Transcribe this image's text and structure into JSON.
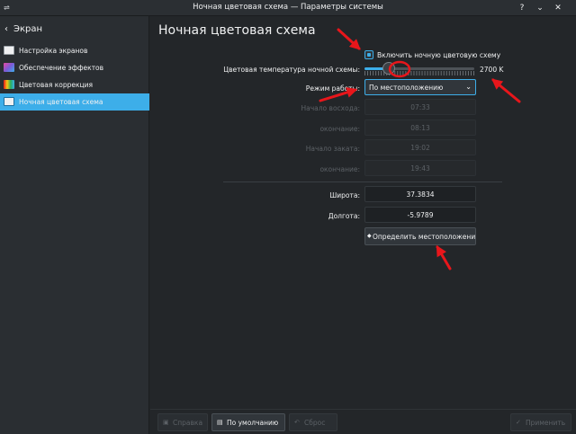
{
  "window": {
    "title": "Ночная цветовая схема — Параметры системы"
  },
  "sidebar": {
    "back_label": "Экран",
    "items": [
      {
        "label": "Настройка экранов",
        "icon": "monitor-icon"
      },
      {
        "label": "Обеспечение эффектов",
        "icon": "effects-monitor-icon"
      },
      {
        "label": "Цветовая коррекция",
        "icon": "color-correction-icon"
      },
      {
        "label": "Ночная цветовая схема",
        "icon": "night-color-monitor-icon",
        "active": true
      }
    ]
  },
  "main": {
    "title": "Ночная цветовая схема",
    "enable_checkbox_label": "Включить ночную цветовую схему",
    "enable_checked": true,
    "temperature_label": "Цветовая температура ночной схемы:",
    "temperature_value": "2700 K",
    "temperature_level": 0.22,
    "mode_label": "Режим работы:",
    "mode_value": "По местоположению",
    "sunrise_label": "Начало восхода:",
    "sunrise_value": "07:33",
    "sunrise_end_label": "окончание:",
    "sunrise_end_value": "08:13",
    "sunset_label": "Начало заката:",
    "sunset_value": "19:02",
    "sunset_end_label": "окончание:",
    "sunset_end_value": "19:43",
    "latitude_label": "Широта:",
    "latitude_value": "37.3834",
    "longitude_label": "Долгота:",
    "longitude_value": "-5.9789",
    "detect_button_label": "Определить местоположени"
  },
  "bottom": {
    "help_label": "Справка",
    "defaults_label": "По умолчанию",
    "reset_label": "Сброс",
    "apply_label": "Применить"
  },
  "colors": {
    "accent": "#3daee9",
    "annotation": "#e8161b",
    "background": "#232629"
  }
}
